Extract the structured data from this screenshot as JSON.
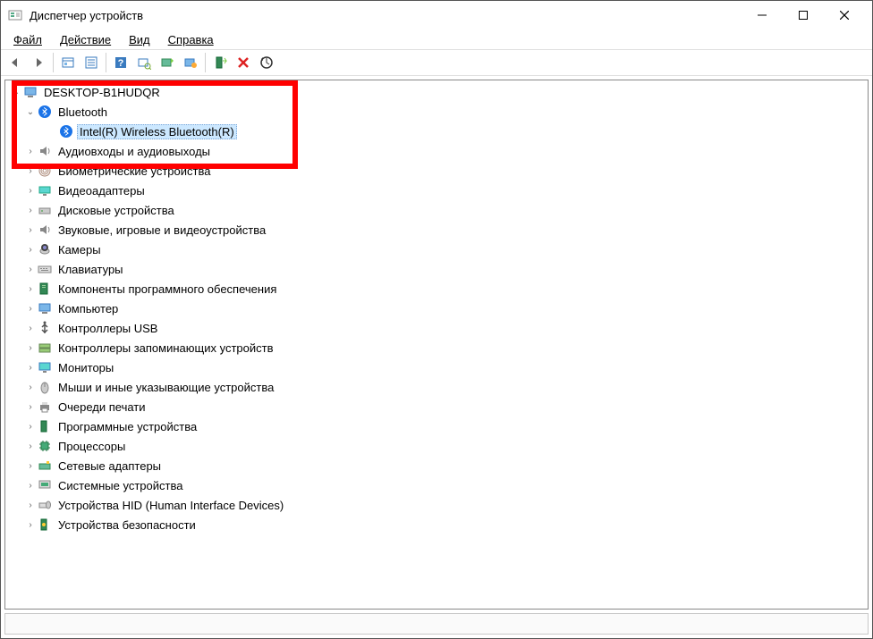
{
  "title": "Диспетчер устройств",
  "window_buttons": {
    "minimize": "—",
    "maximize": "▢",
    "close": "✕"
  },
  "menubar": {
    "file": "Файл",
    "action": "Действие",
    "view": "Вид",
    "help": "Справка"
  },
  "toolbar": {
    "back_icon": "arrow-left",
    "forward_icon": "arrow-right",
    "show_hidden_icon": "show-hidden",
    "properties_icon": "properties",
    "help_icon": "help",
    "scan_icon": "scan",
    "enable_icon": "enable",
    "disable_icon": "disable",
    "add_legacy_icon": "add-legacy",
    "remove_icon": "remove",
    "update_driver_icon": "update-driver"
  },
  "tree": {
    "root": "DESKTOP-B1HUDQR",
    "bluetooth": {
      "label": "Bluetooth",
      "child": "Intel(R) Wireless Bluetooth(R)"
    },
    "categories": [
      "Аудиовходы и аудиовыходы",
      "Б...",
      "Биометрические устройства",
      "Видеоадаптеры",
      "Дисковые устройства",
      "Звуковые, игровые и видеоустройства",
      "Камеры",
      "Клавиатуры",
      "Компоненты программного обеспечения",
      "Компьютер",
      "Контроллеры USB",
      "Контроллеры запоминающих устройств",
      "Мониторы",
      "Мыши и иные указывающие устройства",
      "Очереди печати",
      "Программные устройства",
      "Процессоры",
      "Сетевые адаптеры",
      "Системные устройства",
      "Устройства HID (Human Interface Devices)",
      "Устройства безопасности"
    ]
  },
  "icons": {
    "audio": "speaker-icon",
    "biometric": "fingerprint-icon",
    "display": "monitor-icon",
    "disk": "disk-icon",
    "sound": "speaker-icon",
    "camera": "camera-icon",
    "keyboard": "keyboard-icon",
    "software": "software-icon",
    "computer": "computer-icon",
    "usb": "usb-icon",
    "storage": "storage-icon",
    "monitor": "monitor-icon",
    "mouse": "mouse-icon",
    "printer": "printer-icon",
    "program": "program-icon",
    "cpu": "cpu-icon",
    "network": "network-icon",
    "system": "system-icon",
    "hid": "hid-icon",
    "security": "security-icon"
  }
}
